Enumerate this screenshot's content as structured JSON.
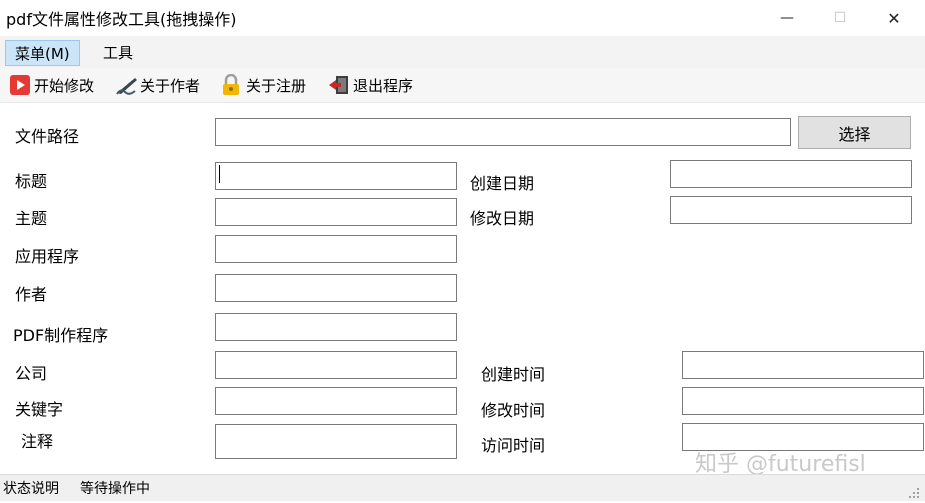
{
  "window": {
    "title": "pdf文件属性修改工具(拖拽操作)",
    "minimize_glyph": "—",
    "maximize_glyph": "☐",
    "close_glyph": "✕"
  },
  "menu": {
    "items": [
      {
        "label": "菜单(M)",
        "active": true
      },
      {
        "label": "工具",
        "active": false
      }
    ]
  },
  "toolbar": {
    "items": [
      {
        "label": "开始修改",
        "icon": "play-icon"
      },
      {
        "label": "关于作者",
        "icon": "pen-icon"
      },
      {
        "label": "关于注册",
        "icon": "lock-icon"
      },
      {
        "label": "退出程序",
        "icon": "exit-icon"
      }
    ]
  },
  "form": {
    "file_path": {
      "label": "文件路径",
      "value": ""
    },
    "select_button": "选择",
    "title": {
      "label": "标题",
      "value": ""
    },
    "subject": {
      "label": "主题",
      "value": ""
    },
    "application": {
      "label": "应用程序",
      "value": ""
    },
    "author": {
      "label": "作者",
      "value": ""
    },
    "pdf_producer": {
      "label": "PDF制作程序",
      "value": ""
    },
    "company": {
      "label": "公司",
      "value": ""
    },
    "keywords": {
      "label": "关键字",
      "value": ""
    },
    "comments": {
      "label": "注释",
      "value": ""
    },
    "created_date": {
      "label": "创建日期",
      "value": ""
    },
    "modified_date": {
      "label": "修改日期",
      "value": ""
    },
    "created_time": {
      "label": "创建时间",
      "value": ""
    },
    "modified_time": {
      "label": "修改时间",
      "value": ""
    },
    "accessed_time": {
      "label": "访问时间",
      "value": ""
    }
  },
  "status": {
    "label": "状态说明",
    "text": "等待操作中"
  },
  "watermark": "知乎 @futurefisl",
  "colors": {
    "menu_active_bg": "#cce4f7",
    "play_icon": "#e53935",
    "lock_icon": "#f2b705",
    "exit_icon": "#c62828"
  }
}
